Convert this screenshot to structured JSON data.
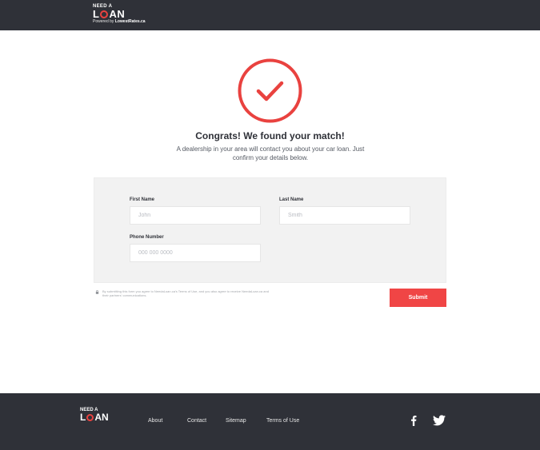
{
  "header": {
    "logo_need": "NEED A",
    "logo_l": "L",
    "logo_an": "AN",
    "powered_prefix": "Powered by ",
    "powered_brand": "LowestRates.ca"
  },
  "hero": {
    "icon": "check-circle-icon",
    "title": "Congrats! We found your match!",
    "subtitle": "A dealership in your area will contact you about your car loan. Just confirm your details below."
  },
  "form": {
    "first_name_label": "First Name",
    "first_name_placeholder": "John",
    "last_name_label": "Last Name",
    "last_name_placeholder": "Smith",
    "phone_label": "Phone Number",
    "phone_placeholder": "000 000 0000",
    "disclaimer": "By submitting this form you agree to NeedaLoan.ca's Terms of Use, and you also agree to receive NeedaLoan.ca and their partners' communications.",
    "submit_label": "Submit"
  },
  "footer": {
    "logo_need": "NEED A",
    "logo_l": "L",
    "logo_an": "AN",
    "links": [
      "About",
      "Contact",
      "Sitemap",
      "Terms of Use"
    ],
    "social": [
      "facebook-icon",
      "twitter-icon"
    ]
  },
  "colors": {
    "dark": "#2f3138",
    "accent": "#f04545",
    "panel": "#f2f2f2"
  }
}
